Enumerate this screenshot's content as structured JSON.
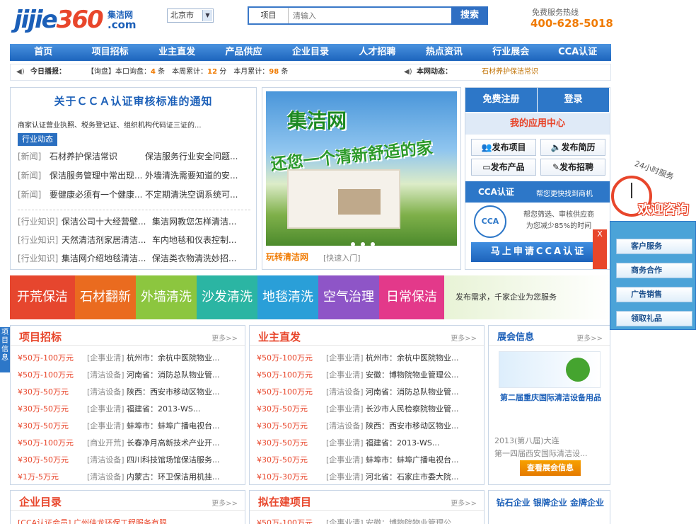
{
  "header": {
    "logo_text_main": "jijie",
    "logo_text_num": "360",
    "logo_cn": "集洁网",
    "logo_domain": ".com",
    "city": "北京市",
    "search_category": "项目",
    "search_placeholder": "清输入",
    "search_button": "搜索",
    "hotline_label": "免费服务热线",
    "hotline_number": "400-628-5018"
  },
  "nav": [
    "首页",
    "项目招标",
    "业主直发",
    "产品供应",
    "企业目录",
    "人才招聘",
    "热点资讯",
    "行业展会",
    "CCA认证"
  ],
  "ticker": {
    "label": "今日播报：",
    "stats_prefix": "【询盘】本口询盘：",
    "today": "4",
    "unit1": "条",
    "week_label": "本周累计：",
    "week": "12",
    "unit2": "分",
    "month_label": "本月累计：",
    "month": "98",
    "unit3": "条",
    "dynamic_label": "本网动态：",
    "dynamic_text": "石材养护保洁常识"
  },
  "news": {
    "headline": "关于ＣＣＡ认证审核标准的通知",
    "summary": "商家认证营业执照、税务登记证、组织机构代码证三证的...",
    "tag": "行业动态",
    "rows1": [
      {
        "k": "[新闻]",
        "a": "石材养护保洁常识",
        "b": "保洁服务行业安全问题..."
      },
      {
        "k": "[新闻]",
        "a": "保洁服务管理中常出现...",
        "b": "外墙清洗需要知道的安..."
      },
      {
        "k": "[新闻]",
        "a": "要健康必须有一个健康...",
        "b": "不定期清洗空调系统可..."
      }
    ],
    "rows2": [
      {
        "k": "[行业知识]",
        "a": "保洁公司十大经营壁...",
        "b": "集洁网教您怎样清洁..."
      },
      {
        "k": "[行业知识]",
        "a": "天然清洁剂家居清洁...",
        "b": "车内地毯和仪表控制..."
      },
      {
        "k": "[行业知识]",
        "a": "集洁网介绍地毯清洁...",
        "b": "保洁类衣物清洗妙招..."
      }
    ]
  },
  "banner": {
    "title1": "集洁网",
    "title2": "还您一个清新舒适的家",
    "caption": "玩转清洁网",
    "caption2": "[快速入门]"
  },
  "user": {
    "register": "免费注册",
    "login": "登录",
    "center": "我的应用中心",
    "actions": [
      "发布项目",
      "发布简历",
      "发布产品",
      "发布招聘"
    ],
    "cca_title": "CCA认证",
    "cca_sub": "帮您更快找到商机",
    "seal": "CCA",
    "cca_desc1": "帮您筛选、审核供应商",
    "cca_desc2": "为您减少85%的时间",
    "apply": "马上申请CCA认证"
  },
  "strip": {
    "items": [
      {
        "label": "开荒保洁",
        "color": "#e6462e"
      },
      {
        "label": "石材翻新",
        "color": "#ea6b1f"
      },
      {
        "label": "外墙清洗",
        "color": "#8cc63f"
      },
      {
        "label": "沙发清洗",
        "color": "#2bb5a3"
      },
      {
        "label": "地毯清洗",
        "color": "#2a9fd8"
      },
      {
        "label": "空气治理",
        "color": "#8e55c7"
      },
      {
        "label": "日常保洁",
        "color": "#e3398a"
      }
    ],
    "ad": "发布需求，千家企业为您服务"
  },
  "tender": {
    "title": "项目招标",
    "more": "更多>>",
    "rows": [
      {
        "p": "¥50万-100万元",
        "g": "[企事业清]",
        "d": "杭州市：余杭中医院物业..."
      },
      {
        "p": "¥50万-100万元",
        "g": "[清洁设备]",
        "d": "河南省：消防总队物业管..."
      },
      {
        "p": "¥30万-50万元",
        "g": "[清洁设备]",
        "d": "陕西：西安市移动区物业..."
      },
      {
        "p": "¥30万-50万元",
        "g": "[企事业清]",
        "d": "福建省：2013-WS..."
      },
      {
        "p": "¥30万-50万元",
        "g": "[企事业清]",
        "d": "蚌埠市：蚌埠广播电视台..."
      },
      {
        "p": "¥50万-100万元",
        "g": "[商业开荒]",
        "d": "长春净月高新技术产业开..."
      },
      {
        "p": "¥30万-50万元",
        "g": "[清洁设备]",
        "d": "四川科技馆场馆保洁服务..."
      },
      {
        "p": "¥1万-5万元",
        "g": "[清洁设备]",
        "d": "内蒙古：环卫保洁用机挂..."
      }
    ]
  },
  "owner": {
    "title": "业主直发",
    "more": "更多>>",
    "rows": [
      {
        "p": "¥50万-100万元",
        "g": "[企事业清]",
        "d": "杭州市：余杭中医院物业..."
      },
      {
        "p": "¥50万-100万元",
        "g": "[企事业清]",
        "d": "安徽：博物院物业管理公..."
      },
      {
        "p": "¥50万-100万元",
        "g": "[清洁设备]",
        "d": "河南省：消防总队物业管..."
      },
      {
        "p": "¥30万-50万元",
        "g": "[企事业清]",
        "d": "长沙市人民检察院物业管..."
      },
      {
        "p": "¥30万-50万元",
        "g": "[清洁设备]",
        "d": "陕西：西安市移动区物业..."
      },
      {
        "p": "¥30万-50万元",
        "g": "[企事业清]",
        "d": "福建省：2013-WS..."
      },
      {
        "p": "¥30万-50万元",
        "g": "[企事业清]",
        "d": "蚌埠市：蚌埠广播电视台..."
      },
      {
        "p": "¥10万-30万元",
        "g": "[企事业清]",
        "d": "河北省：石家庄市委大院..."
      }
    ]
  },
  "exhibition": {
    "title": "展会信息",
    "more": "更多>>",
    "name": "第二届重庆国际清洁设备用品",
    "line1": "2013(第八届)大连",
    "line2": "第一四届西安国际清洁设...",
    "button": "查看展会信息"
  },
  "directory": {
    "title": "企业目录",
    "more": "更多>>",
    "peek": "[CCA认证会员] 广州佳龙环保工程服务有限"
  },
  "planned": {
    "title": "拟在建项目",
    "more": "更多>>",
    "peek_p": "¥50万-100万元",
    "peek_d": "[企事业清] 安徽：博物院物业管理公"
  },
  "brands": {
    "items": [
      "钻石企业",
      "银牌企业",
      "金牌企业"
    ]
  },
  "edge_tab": "项目信息",
  "float": {
    "h24": "24小时服务",
    "welcome": "欢迎咨询",
    "buttons": [
      "客户服务",
      "商务合作",
      "广告销售",
      "领取礼品"
    ],
    "close": "X"
  }
}
